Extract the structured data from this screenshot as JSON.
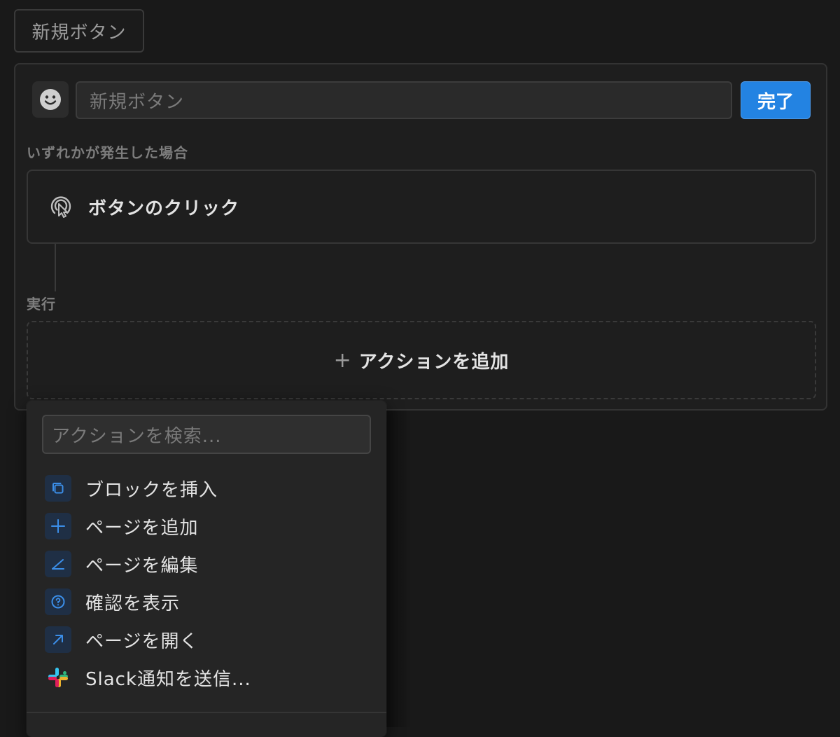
{
  "top_chip": {
    "label": "新規ボタン"
  },
  "editor": {
    "emoji_icon": "smiley-icon",
    "name_input": {
      "placeholder": "新規ボタン"
    },
    "done_label": "完了",
    "trigger_section_label": "いずれかが発生した場合",
    "trigger": {
      "label": "ボタンのクリック",
      "icon": "click-cursor-icon"
    },
    "action_section_label": "実行",
    "add_action": {
      "plus": "+",
      "label": "アクションを追加"
    }
  },
  "dropdown": {
    "search_placeholder": "アクションを検索...",
    "items": [
      {
        "label": "ブロックを挿入",
        "icon": "copy-block-icon"
      },
      {
        "label": "ページを追加",
        "icon": "plus-icon"
      },
      {
        "label": "ページを編集",
        "icon": "edit-angle-icon"
      },
      {
        "label": "確認を表示",
        "icon": "question-circle-icon"
      },
      {
        "label": "ページを開く",
        "icon": "arrow-up-right-icon"
      },
      {
        "label": "Slack通知を送信...",
        "icon": "slack-icon"
      }
    ]
  },
  "colors": {
    "background": "#191919",
    "accent": "#2383e2",
    "icon_blue": "#3b8ee8",
    "icon_bg": "#1f2f45"
  }
}
